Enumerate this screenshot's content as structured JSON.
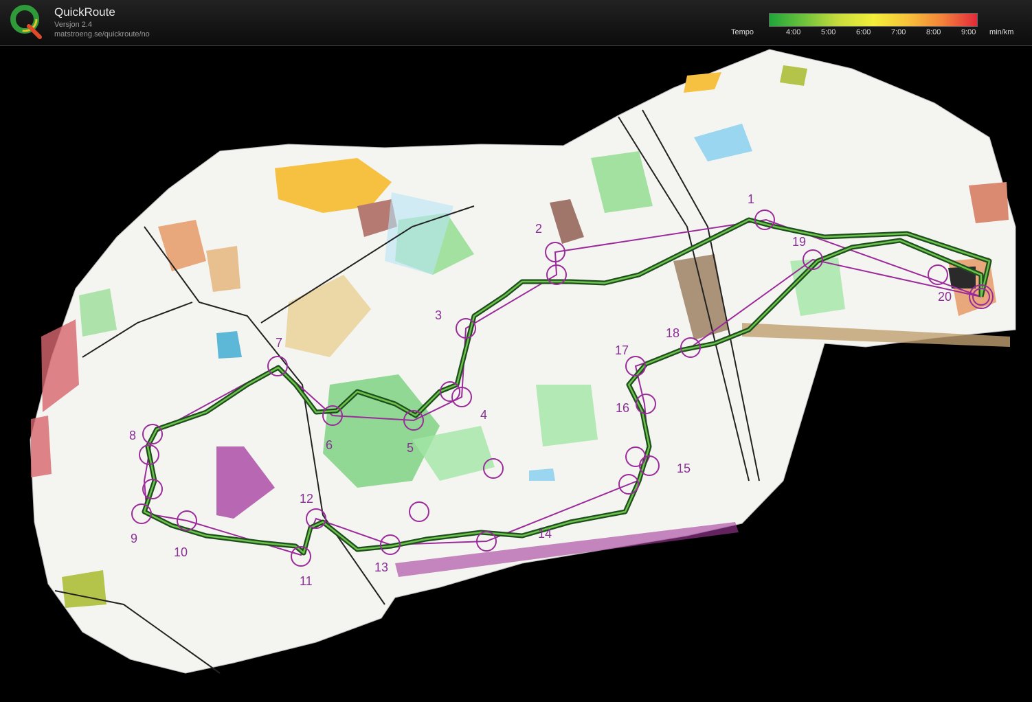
{
  "header": {
    "title": "QuickRoute",
    "version": "Versjon 2.4",
    "url": "matstroeng.se/quickroute/no"
  },
  "legend": {
    "tempo_label": "Tempo",
    "ticks": [
      "4:00",
      "5:00",
      "6:00",
      "7:00",
      "8:00",
      "9:00"
    ],
    "unit": "min/km",
    "gradient_colors": [
      "#1fa53a",
      "#6ec23c",
      "#c9dc3c",
      "#f2ee3a",
      "#f6c23a",
      "#f3823a",
      "#e22a3a"
    ]
  },
  "map": {
    "controls": [
      "1",
      "2",
      "3",
      "4",
      "5",
      "6",
      "7",
      "8",
      "9",
      "10",
      "11",
      "12",
      "13",
      "14",
      "15",
      "16",
      "17",
      "18",
      "19",
      "20"
    ],
    "course_color": "#9b2b9a",
    "route_color": "#2f7a2f"
  }
}
